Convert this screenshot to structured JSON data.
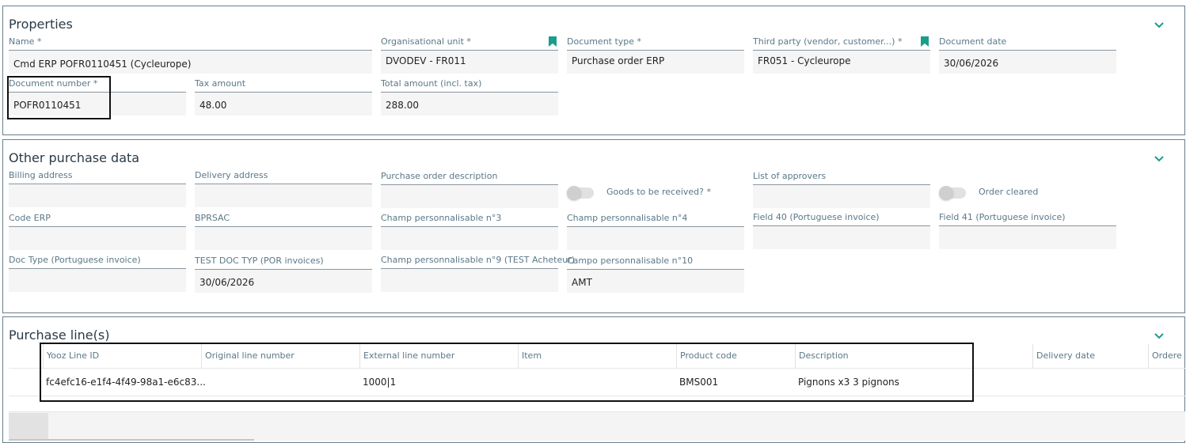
{
  "properties": {
    "title": "Properties",
    "fields": {
      "name": {
        "label": "Name *",
        "value": "Cmd ERP POFR0110451 (Cycleurope)"
      },
      "org_unit": {
        "label": "Organisational unit *",
        "value": "DVODEV - FR011"
      },
      "doc_type": {
        "label": "Document type *",
        "value": "Purchase order ERP"
      },
      "third_party": {
        "label": "Third party (vendor, customer...) *",
        "value": "FR051 - Cycleurope"
      },
      "doc_date": {
        "label": "Document date",
        "value": "30/06/2026"
      },
      "doc_number": {
        "label": "Document number *",
        "value": "POFR0110451"
      },
      "tax_amount": {
        "label": "Tax amount",
        "value": "48.00"
      },
      "total_amount": {
        "label": "Total amount (incl. tax)",
        "value": "288.00"
      }
    }
  },
  "other": {
    "title": "Other purchase data",
    "fields": {
      "billing": {
        "label": "Billing address",
        "value": ""
      },
      "delivery": {
        "label": "Delivery address",
        "value": ""
      },
      "po_desc": {
        "label": "Purchase order description",
        "value": ""
      },
      "approvers": {
        "label": "List of approvers",
        "value": ""
      },
      "code_erp": {
        "label": "Code ERP",
        "value": ""
      },
      "bprsac": {
        "label": "BPRSAC",
        "value": ""
      },
      "champ3": {
        "label": "Champ personnalisable n°3",
        "value": ""
      },
      "champ4": {
        "label": "Champ personnalisable n°4",
        "value": ""
      },
      "field40": {
        "label": "Field 40 (Portuguese invoice)",
        "value": ""
      },
      "field41": {
        "label": "Field 41 (Portuguese invoice)",
        "value": ""
      },
      "doc_type_pt": {
        "label": "Doc Type (Portuguese invoice)",
        "value": ""
      },
      "test_doc_typ": {
        "label": "TEST DOC TYP (POR invoices)",
        "value": "30/06/2026"
      },
      "champ9": {
        "label": "Champ personnalisable n°9 (TEST Acheteur)",
        "value": ""
      },
      "campo10": {
        "label": "Campo personnalisable n°10",
        "value": "AMT"
      }
    },
    "toggles": {
      "goods": {
        "label": "Goods to be received? *",
        "state": "off"
      },
      "order_cleared": {
        "label": "Order cleared",
        "state": "off"
      }
    }
  },
  "purchase_lines": {
    "title": "Purchase line(s)",
    "columns": [
      "Yooz Line ID",
      "Original line number",
      "External line number",
      "Item",
      "Product code",
      "Description",
      "Delivery date",
      "Ordere"
    ],
    "rows": [
      {
        "yooz_line_id": "fc4efc16-e1f4-4f49-98a1-e6c83...",
        "original_line_number": "",
        "external_line_number": "1000|1",
        "item": "",
        "product_code": "BMS001",
        "description": "Pignons x3 3 pignons",
        "delivery_date": "",
        "ordered": ""
      }
    ]
  },
  "icons": {
    "chevron": "chevron-down-icon",
    "bookmark": "bookmark-icon"
  },
  "colors": {
    "accent": "#1a9e8a",
    "panel_border": "#6b7f8c",
    "label": "#5a7888"
  }
}
